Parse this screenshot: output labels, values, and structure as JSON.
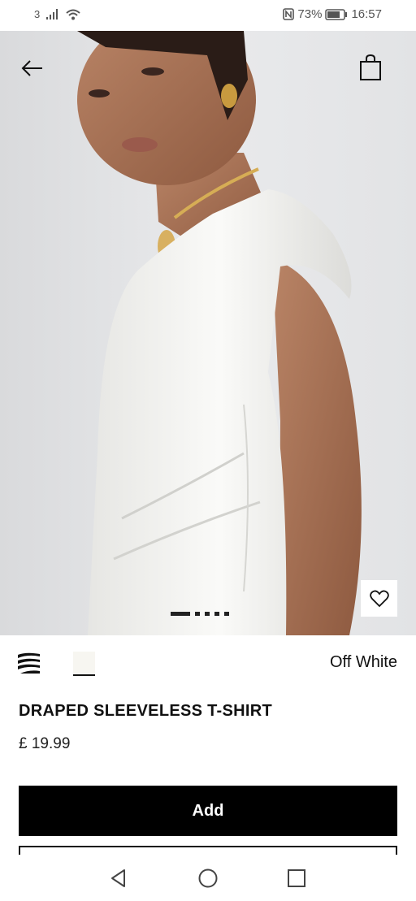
{
  "status_bar": {
    "sim_label": "3",
    "battery_percent": "73%",
    "time": "16:57",
    "nfc_icon": "nfc-icon",
    "signal_icon": "signal-icon",
    "wifi_icon": "wifi-icon",
    "battery_icon": "battery-icon"
  },
  "header": {
    "back_icon": "arrow-left-icon",
    "bag_icon": "shopping-bag-icon"
  },
  "gallery": {
    "image_count": 5,
    "active_index": 0,
    "favorite_icon": "heart-icon"
  },
  "colors": {
    "swatches": [
      "zebra-print",
      "off-white"
    ],
    "selected_index": 1,
    "selected_name": "Off White"
  },
  "product": {
    "title": "DRAPED SLEEVELESS T-SHIRT",
    "price": "£ 19.99"
  },
  "actions": {
    "add_label": "Add"
  },
  "nav": {
    "back_icon": "triangle-back-icon",
    "home_icon": "circle-home-icon",
    "recents_icon": "square-recents-icon"
  },
  "theme": {
    "accent": "#000000",
    "background": "#ffffff",
    "hero_bg": "#e8e9eb"
  }
}
